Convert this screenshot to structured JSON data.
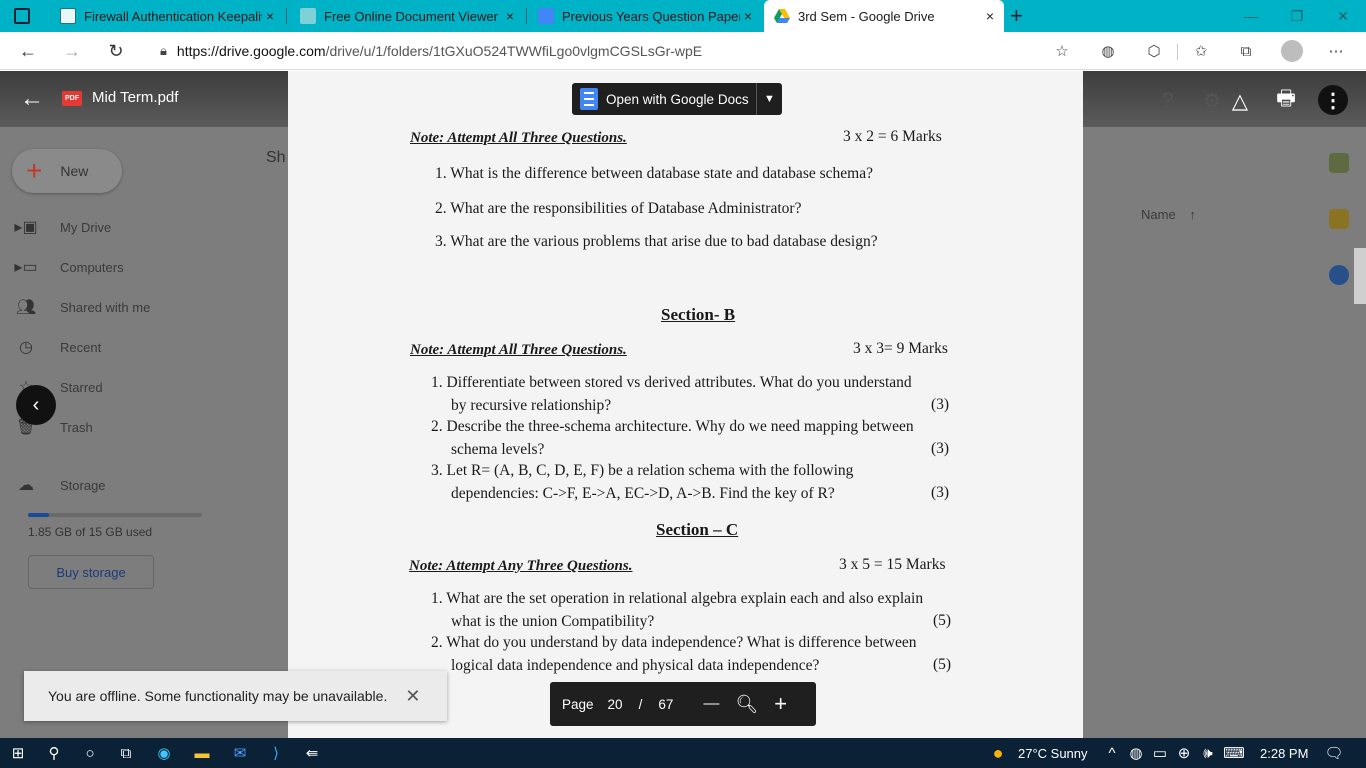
{
  "browser": {
    "tabs": [
      {
        "title": "Firewall Authentication Keepalive",
        "close": "×"
      },
      {
        "title": "Free Online Document Viewer",
        "close": "×"
      },
      {
        "title": "Previous Years Question Papers -",
        "close": "×"
      },
      {
        "title": "3rd Sem - Google Drive",
        "close": "×",
        "active": true
      }
    ],
    "new_tab": "+",
    "url_host": "https://drive.google.com",
    "url_path": "/drive/u/1/folders/1tGXuO524TWWfiLgo0vlgmCGSLsGr-wpE"
  },
  "viewer": {
    "file_name": "Mid Term.pdf",
    "pdf_badge": "PDF",
    "open_with": "Open with Google Docs"
  },
  "drive": {
    "new_label": "New",
    "sidebar": [
      {
        "label": "My Drive",
        "icon": "drive-icon"
      },
      {
        "label": "Computers",
        "icon": "computer-icon"
      },
      {
        "label": "Shared with me",
        "icon": "people-icon"
      },
      {
        "label": "Recent",
        "icon": "clock-icon"
      },
      {
        "label": "Starred",
        "icon": "star-icon"
      },
      {
        "label": "Trash",
        "icon": "trash-icon"
      }
    ],
    "storage_label": "Storage",
    "storage_used": "1.85 GB of 15 GB used",
    "storage_fraction": 0.123,
    "buy_storage": "Buy storage",
    "sort_label": "Name",
    "sh_fragment": "Sh"
  },
  "document": {
    "secA_note": "Note: Attempt All Three Questions.",
    "secA_marks": "3 x 2 = 6 Marks",
    "secA_q": [
      "1. What is the difference between database state and database schema?",
      "2. What are the responsibilities of Database Administrator?",
      "3. What are the various problems that arise due to bad database design?"
    ],
    "secB_title": "Section- B",
    "secB_note": "Note: Attempt All Three Questions.",
    "secB_marks": "3 x 3= 9 Marks",
    "secB_lines": [
      "1. Differentiate between stored vs derived attributes. What do you understand",
      "by recursive relationship?",
      "2. Describe the three-schema architecture. Why do we need mapping between",
      "schema levels?",
      "3. Let R= (A, B, C, D, E, F) be a relation schema with the following",
      "dependencies: C->F, E->A, EC->D, A->B. Find the key of R?"
    ],
    "secB_pts": [
      "(3)",
      "(3)",
      "(3)"
    ],
    "secC_title": "Section – C",
    "secC_note": "Note: Attempt Any Three Questions.",
    "secC_marks": "3 x 5 = 15 Marks",
    "secC_lines": [
      "1. What are the set operation in relational algebra explain each and also explain",
      "what is the union Compatibility?",
      "2. What do you understand by data independence? What is difference between",
      "logical data independence and physical data independence?"
    ],
    "secC_pts": [
      "(5)",
      "(5)"
    ]
  },
  "pager": {
    "label": "Page",
    "current": "20",
    "sep": "/",
    "total": "67",
    "minus": "—",
    "plus": "+"
  },
  "toast": {
    "message": "You are offline. Some functionality may be unavailable.",
    "close": "✕"
  },
  "taskbar": {
    "weather": "27°C  Sunny",
    "time": "2:28 PM"
  }
}
